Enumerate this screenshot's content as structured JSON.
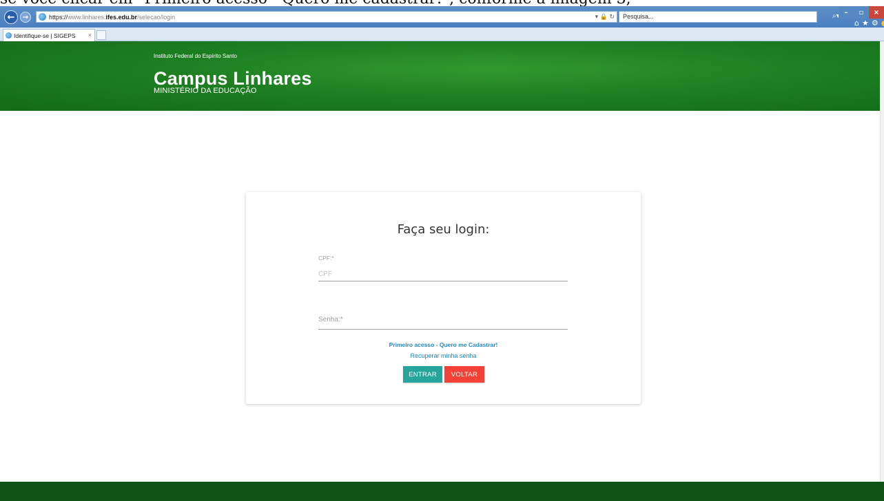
{
  "caption": {
    "text": "se você clicar em \"Primeiro acesso - Quero me cadastrar!\", conforme a imagem 3,"
  },
  "browser": {
    "url_scheme": "https://",
    "url_prefix": "www.linhares.",
    "url_host": "ifes.edu.br",
    "url_path": "/selecao/login",
    "search_placeholder": "Pesquisa...",
    "tab_title": "Identifique-se | SIGEPS",
    "tab_close": "×"
  },
  "header": {
    "institution": "Instituto Federal do Espírito Santo",
    "campus": "Campus Linhares",
    "ministry": "MINISTÉRIO DA EDUCAÇÃO"
  },
  "login": {
    "title": "Faça seu login:",
    "cpf_label": "CPF:*",
    "cpf_placeholder": "CPF",
    "cpf_value": "",
    "senha_label": "Senha:*",
    "senha_value": "",
    "first_access_link": "Primeiro acesso - Quero me Cadastrar!",
    "recover_link": "Recuperar minha senha",
    "enter_button": "ENTRAR",
    "back_button": "VOLTAR"
  },
  "colors": {
    "header_green": "#1e7f22",
    "footer_green": "#0f5318",
    "link_blue": "#1e88c8",
    "enter_teal": "#26a69a",
    "back_red": "#f44336"
  }
}
